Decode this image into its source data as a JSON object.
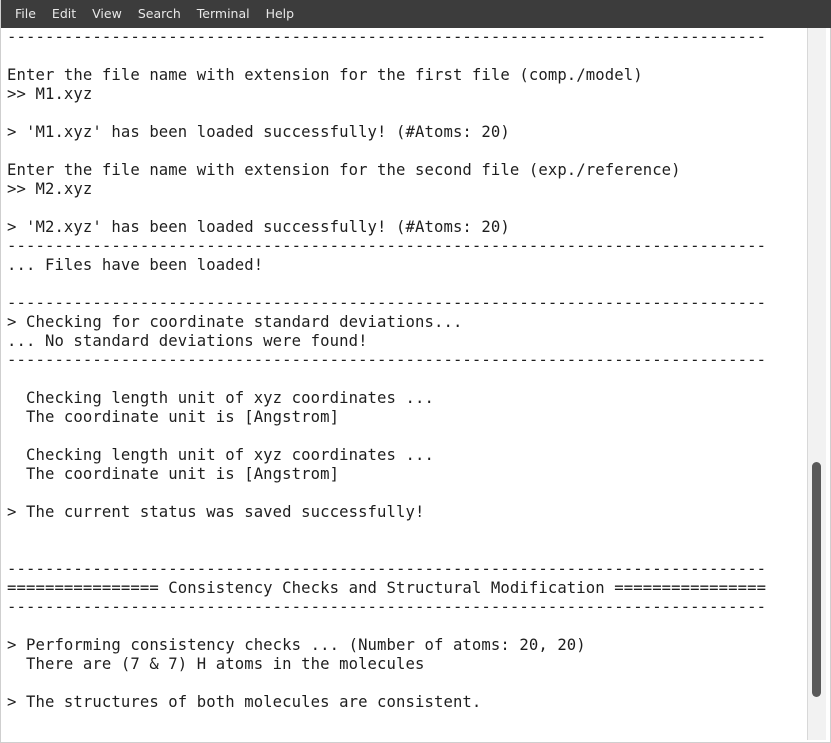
{
  "menu": [
    "File",
    "Edit",
    "View",
    "Search",
    "Terminal",
    "Help"
  ],
  "terminal": {
    "lines": [
      "--------------------------------------------------------------------------------",
      "",
      "Enter the file name with extension for the first file (comp./model)",
      ">> M1.xyz",
      "",
      "> 'M1.xyz' has been loaded successfully! (#Atoms: 20)",
      "",
      "Enter the file name with extension for the second file (exp./reference)",
      ">> M2.xyz",
      "",
      "> 'M2.xyz' has been loaded successfully! (#Atoms: 20)",
      "--------------------------------------------------------------------------------",
      "... Files have been loaded!",
      "",
      "--------------------------------------------------------------------------------",
      "> Checking for coordinate standard deviations...",
      "... No standard deviations were found!",
      "--------------------------------------------------------------------------------",
      "",
      "  Checking length unit of xyz coordinates ...",
      "  The coordinate unit is [Angstrom]",
      "",
      "  Checking length unit of xyz coordinates ...",
      "  The coordinate unit is [Angstrom]",
      "",
      "> The current status was saved successfully!",
      "",
      "",
      "--------------------------------------------------------------------------------",
      "================ Consistency Checks and Structural Modification ================",
      "--------------------------------------------------------------------------------",
      "",
      "> Performing consistency checks ... (Number of atoms: 20, 20)",
      "  There are (7 & 7) H atoms in the molecules",
      "",
      "> The structures of both molecules are consistent.",
      "",
      ""
    ]
  },
  "scrollbar": {
    "thumb_start_fraction": 0.61,
    "thumb_length_fraction": 0.33
  }
}
